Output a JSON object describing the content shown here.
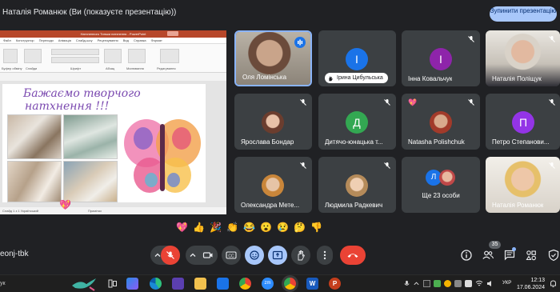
{
  "header": {
    "presenter_title": "Наталія Романюк (Ви (показуєте презентацію))",
    "stop_button": "Зупинити презентацію"
  },
  "slide": {
    "app_title": "Натхненного Тиньки натхнення - PowerPoint",
    "tabs": [
      "Файл",
      "Конструктор",
      "Переходи",
      "Анімація",
      "Слайд-шоу",
      "Рецензування",
      "Вид",
      "Справка",
      "Формат"
    ],
    "ribbon_groups": [
      "Буфер обміну",
      "Слайди",
      "Шрифт",
      "Абзац",
      "Малювання",
      "Редагування"
    ],
    "title_line1": "Бажаємо творчого",
    "title_line2": "натхнення !!!",
    "status_left": "Слайд 1 з 1   Український",
    "status_right": "Примітки"
  },
  "participants": [
    {
      "name": "Оля Ломінська",
      "type": "video",
      "speaking": true
    },
    {
      "name": "Ірина Цибульська",
      "type": "letter",
      "letter": "І",
      "color": "#1a73e8"
    },
    {
      "name": "Інна Ковальчук",
      "type": "letter",
      "letter": "І",
      "color": "#8e24aa"
    },
    {
      "name": "Наталія Поліщук",
      "type": "video"
    },
    {
      "name": "Ярослава Бондар",
      "type": "photo"
    },
    {
      "name": "Дитячо-юнацька т...",
      "type": "letter",
      "letter": "Д",
      "color": "#33a852"
    },
    {
      "name": "Natasha Polishchuk",
      "type": "photo"
    },
    {
      "name": "Петро Степанови...",
      "type": "letter",
      "letter": "П",
      "color": "#9334e6"
    },
    {
      "name": "Олександра Мете...",
      "type": "photo"
    },
    {
      "name": "Людмила Радкевич",
      "type": "photo"
    },
    {
      "name": "Ще 23 особи",
      "type": "group",
      "letter": "Л"
    },
    {
      "name": "Наталія Романюк",
      "type": "video"
    }
  ],
  "reactions": [
    "💖",
    "👍",
    "🎉",
    "👏",
    "😂",
    "😮",
    "😢",
    "🤔",
    "👎"
  ],
  "meeting": {
    "code": "eonj-tbk",
    "participants_count": "35"
  },
  "controls": {
    "mic": "mic-off",
    "camera": "camera",
    "captions": "CC",
    "end_call": "end-call"
  },
  "taskbar": {
    "search_text": "ук",
    "lang": "УКР",
    "time": "12:13",
    "date": "17.06.2024"
  },
  "colors": {
    "accent": "#a8c7fa",
    "end_call": "#ea4335",
    "tile_bg": "#3c4043",
    "bg": "#202124"
  }
}
